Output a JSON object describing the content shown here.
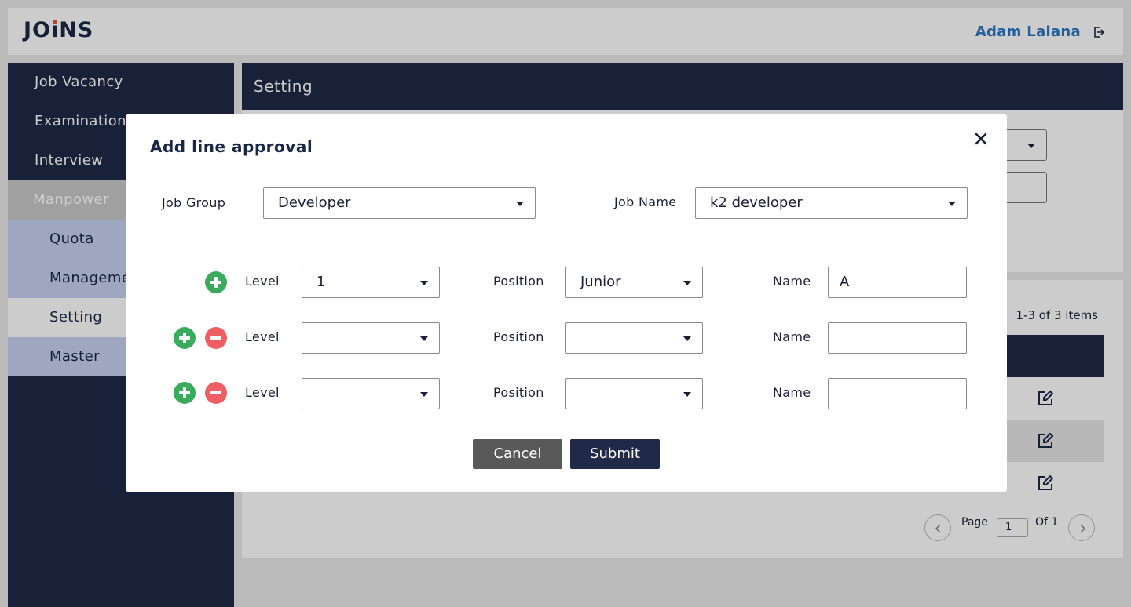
{
  "app": {
    "logo": "JOiNS",
    "user_name": "Adam Lalana"
  },
  "sidebar": {
    "items": [
      {
        "label": "Job Vacancy"
      },
      {
        "label": "Examination"
      },
      {
        "label": "Interview"
      },
      {
        "label": "Manpower"
      }
    ],
    "sub_items": [
      {
        "label": "Quota"
      },
      {
        "label": "Management"
      },
      {
        "label": "Setting"
      },
      {
        "label": "Master"
      }
    ]
  },
  "main": {
    "title": "Setting",
    "list_count": "1-3 of 3 items",
    "pagination": {
      "page_label": "Page",
      "page_value": "1",
      "of_label": "Of 1"
    }
  },
  "modal": {
    "title": "Add line approval",
    "job_group": {
      "label": "Job Group",
      "value": "Developer"
    },
    "job_name": {
      "label": "Job Name",
      "value": "k2 developer"
    },
    "rows": [
      {
        "level_label": "Level",
        "level": "1",
        "position_label": "Position",
        "position": "Junior",
        "name_label": "Name",
        "name": "A"
      },
      {
        "level_label": "Level",
        "level": "",
        "position_label": "Position",
        "position": "",
        "name_label": "Name",
        "name": ""
      },
      {
        "level_label": "Level",
        "level": "",
        "position_label": "Position",
        "position": "",
        "name_label": "Name",
        "name": ""
      }
    ],
    "cancel_label": "Cancel",
    "submit_label": "Submit"
  }
}
